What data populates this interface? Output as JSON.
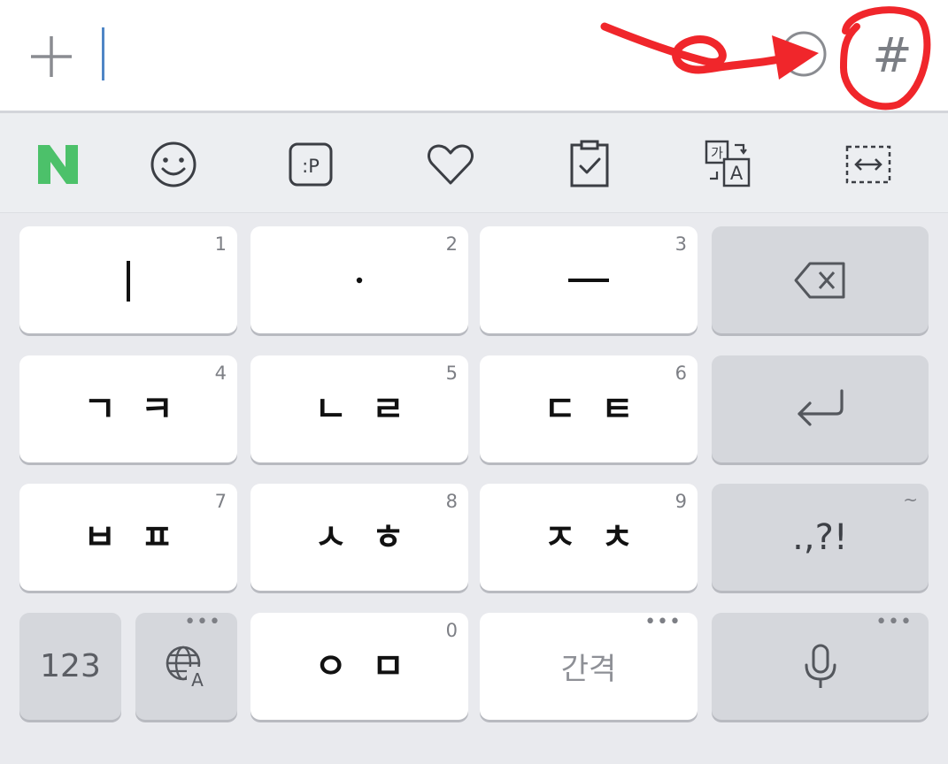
{
  "input": {
    "plus_icon": "plus-icon",
    "emoji_icon": "emoji-icon",
    "hashtag_label": "#"
  },
  "toolbar": {
    "items": [
      {
        "name": "naver-logo",
        "label": "N",
        "color": "#4cc16a"
      },
      {
        "name": "emoticon-icon"
      },
      {
        "name": "sticker-icon",
        "label": ":P"
      },
      {
        "name": "heart-icon"
      },
      {
        "name": "clipboard-icon"
      },
      {
        "name": "translate-icon",
        "label_ko": "가",
        "label_en": "A"
      },
      {
        "name": "one-hand-mode-icon"
      }
    ]
  },
  "keys": {
    "row1": [
      {
        "num": "1",
        "glyph": "ㅣ"
      },
      {
        "num": "2",
        "glyph": "·"
      },
      {
        "num": "3",
        "glyph": "ㅡ"
      }
    ],
    "row2": [
      {
        "num": "4",
        "glyph": "ㄱㅋ"
      },
      {
        "num": "5",
        "glyph": "ㄴㄹ"
      },
      {
        "num": "6",
        "glyph": "ㄷㅌ"
      }
    ],
    "row3": [
      {
        "num": "7",
        "glyph": "ㅂㅍ"
      },
      {
        "num": "8",
        "glyph": "ㅅㅎ"
      },
      {
        "num": "9",
        "glyph": "ㅈㅊ"
      }
    ],
    "row4": {
      "number_mode": "123",
      "zero_num": "0",
      "zero_glyph": "ㅇㅁ",
      "space_label": "간격",
      "more_dots": "•••"
    },
    "side": {
      "backspace_icon": "backspace-icon",
      "enter_icon": "enter-icon",
      "punct_label": ".,?!",
      "punct_hint": "~",
      "globe_icon": "globe-icon",
      "mic_icon": "microphone-icon"
    }
  },
  "colors": {
    "annotation_red": "#f0262b",
    "caret_blue": "#4f86c6",
    "naver_green": "#4cc16a"
  }
}
